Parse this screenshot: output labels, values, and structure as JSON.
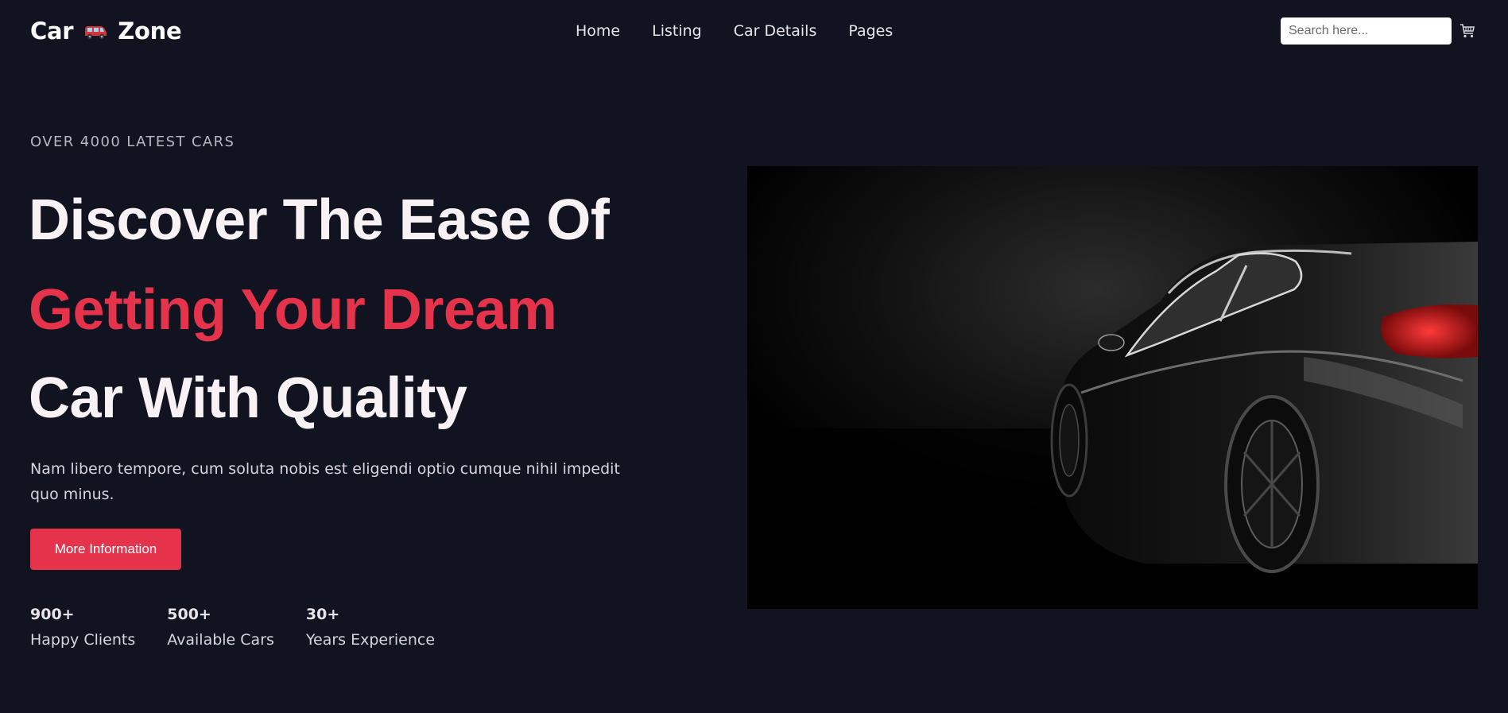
{
  "brand": {
    "left": "Car",
    "right": "Zone",
    "icon": "minivan-emoji-icon"
  },
  "nav": {
    "items": [
      "Home",
      "Listing",
      "Car Details",
      "Pages"
    ]
  },
  "search": {
    "placeholder": "Search here..."
  },
  "cart": {
    "icon": "cart-icon"
  },
  "hero": {
    "eyebrow": "OVER 4000 LATEST CARS",
    "line1": "Discover The Ease Of",
    "line2": "Getting Your Dream",
    "line3": "Car With Quality",
    "lead": "Nam libero tempore, cum soluta nobis est eligendi optio cumque nihil impedit quo minus.",
    "button": "More Information",
    "accent_color": "#e5334b"
  },
  "stats": [
    {
      "value": "900+",
      "label": "Happy Clients"
    },
    {
      "value": "500+",
      "label": "Available Cars"
    },
    {
      "value": "30+",
      "label": "Years Experience"
    }
  ]
}
